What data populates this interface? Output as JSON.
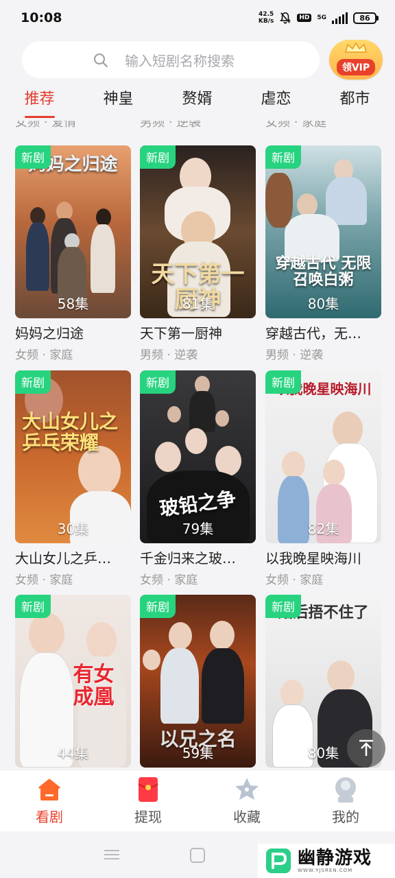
{
  "status": {
    "time": "10:08",
    "speed_value": "42.5",
    "speed_unit": "KB/s",
    "hd": "HD",
    "network": "5G",
    "battery": "86"
  },
  "search": {
    "placeholder": "输入短剧名称搜索"
  },
  "vip": {
    "label": "领VIP"
  },
  "tabs": [
    "推荐",
    "神皇",
    "赘婿",
    "虐恋",
    "都市"
  ],
  "active_tab": "推荐",
  "prev_row_tags": [
    "女频 · 爱情",
    "男频 · 逆袭",
    "女频 · 家庭"
  ],
  "dramas": [
    {
      "badge": "新剧",
      "episodes": "58集",
      "title": "妈妈之归途",
      "tags": "女频 · 家庭",
      "poster_text": "妈妈之归途"
    },
    {
      "badge": "新剧",
      "episodes": "81集",
      "title": "天下第一厨神",
      "tags": "男频 · 逆袭",
      "poster_text": "天下第一厨神"
    },
    {
      "badge": "新剧",
      "episodes": "80集",
      "title": "穿越古代，无…",
      "tags": "男频 · 逆袭",
      "poster_text": "穿越古代 无限召唤白粥"
    },
    {
      "badge": "新剧",
      "episodes": "30集",
      "title": "大山女儿之乒…",
      "tags": "女频 · 家庭",
      "poster_text": "大山女儿之 乒乓荣耀"
    },
    {
      "badge": "新剧",
      "episodes": "79集",
      "title": "千金归来之玻…",
      "tags": "女频 · 家庭",
      "poster_text": "玻铅之争"
    },
    {
      "badge": "新剧",
      "episodes": "82集",
      "title": "以我晚星映海川",
      "tags": "女频 · 家庭",
      "poster_text": "以我晚星映海川"
    },
    {
      "badge": "新剧",
      "episodes": "44集",
      "title": "",
      "tags": "",
      "poster_text": "有女成凰"
    },
    {
      "badge": "新剧",
      "episodes": "59集",
      "title": "",
      "tags": "",
      "poster_text": "以兄之名"
    },
    {
      "badge": "新剧",
      "episodes": "80集",
      "title": "",
      "tags": "",
      "poster_text": "婚后捂不住了"
    }
  ],
  "bottom_nav": [
    {
      "label": "看剧",
      "icon": "home-tv-icon",
      "active": true
    },
    {
      "label": "提现",
      "icon": "red-envelope-icon",
      "active": false
    },
    {
      "label": "收藏",
      "icon": "star-icon",
      "active": false
    },
    {
      "label": "我的",
      "icon": "profile-icon",
      "active": false
    }
  ],
  "watermark": {
    "name": "幽静游戏",
    "url": "WWW.YJSREN.COM"
  },
  "colors": {
    "accent": "#e43d2e",
    "new_badge": "#27d37f",
    "background": "#f4f4f6"
  }
}
